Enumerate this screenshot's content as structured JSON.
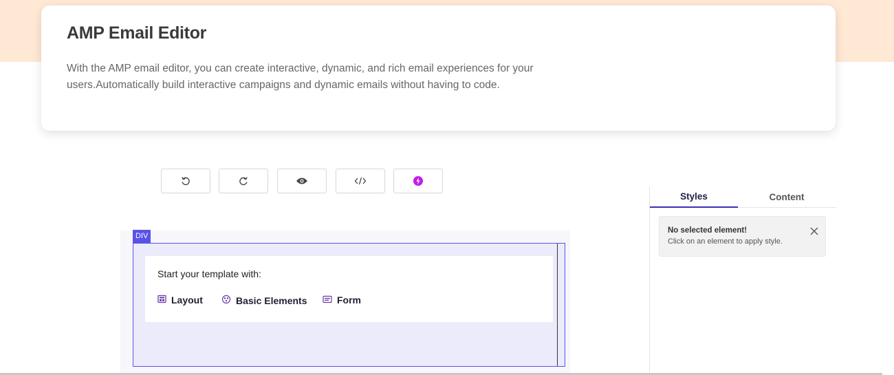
{
  "header": {
    "title": "AMP Email Editor",
    "description": "With the AMP email editor, you can create interactive, dynamic, and rich email experiences for your users.Automatically build interactive campaigns and dynamic emails without having to code."
  },
  "toolbar": {
    "buttons": [
      {
        "icon": "undo-icon"
      },
      {
        "icon": "redo-icon"
      },
      {
        "icon": "eye-icon"
      },
      {
        "icon": "code-icon"
      },
      {
        "icon": "lightning-icon"
      }
    ]
  },
  "canvas": {
    "element_tag": "DIV",
    "start_title": "Start your template with:",
    "options": [
      {
        "label": "Layout",
        "icon": "layout-icon"
      },
      {
        "label": "Basic Elements",
        "icon": "basic-elements-icon"
      },
      {
        "label": "Form",
        "icon": "form-icon"
      }
    ]
  },
  "panel": {
    "tabs": [
      {
        "label": "Styles",
        "active": true
      },
      {
        "label": "Content",
        "active": false
      }
    ],
    "notice": {
      "title": "No selected element!",
      "text": "Click on an element to apply style."
    }
  },
  "colors": {
    "hero_background": "#ffe8d4",
    "accent": "#5a52e8",
    "tab_active": "#3a2fb2",
    "amp_lightning": "#c41de8"
  }
}
